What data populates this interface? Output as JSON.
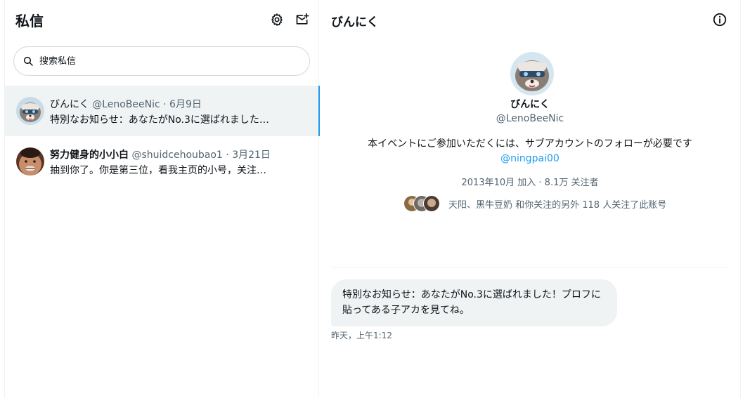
{
  "sidebar": {
    "title": "私信",
    "search_placeholder": "搜索私信",
    "conversations": [
      {
        "name": "びんにく",
        "handle": "@LenoBeeNic",
        "date": "· 6月9日",
        "preview": "特別なお知らせ：あなたがNo.3に選ばれました…",
        "active": true
      },
      {
        "name": "努力健身的小小白",
        "handle": "@shuidcehoubao1",
        "date": "· 3月21日",
        "preview": "抽到你了。你是第三位，看我主页的小号，关注…",
        "active": false
      }
    ]
  },
  "chat": {
    "title": "びんにく",
    "profile": {
      "name": "びんにく",
      "handle": "@LenoBeeNic",
      "bio": "本イベントにご参加いただくには、サブアカウントのフォローが必要です",
      "bio_link": "@ningpai00",
      "meta": "2013年10月 加入 · 8.1万 关注者",
      "followers_text": "天阳、黑牛豆奶 和你关注的另外 118 人关注了此账号"
    },
    "messages": [
      {
        "text": "特別なお知らせ：あなたがNo.3に選ばれました！プロフに貼ってある子アカを見てね。",
        "time": "昨天，上午1:12"
      }
    ]
  },
  "icons": {
    "settings": "gear-icon",
    "new_message": "new-message-icon",
    "search": "search-icon",
    "info": "info-icon"
  },
  "colors": {
    "accent": "#1d9bf0",
    "muted_text": "#536471",
    "selected_bg": "#eff3f4"
  }
}
